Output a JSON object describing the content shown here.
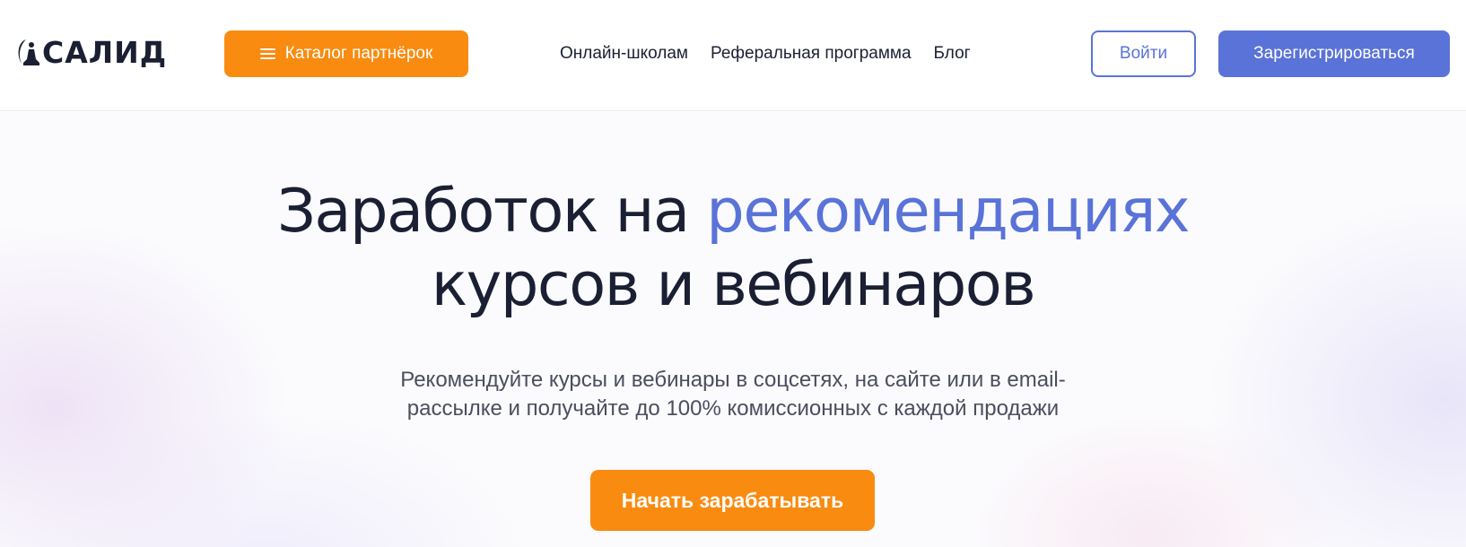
{
  "header": {
    "logo_text": "САЛИД",
    "logo_icon": "meditating-figure-icon",
    "catalog_button": {
      "label": "Каталог партнёрок",
      "icon": "menu-icon"
    },
    "nav": [
      {
        "label": "Онлайн-школам"
      },
      {
        "label": "Реферальная программа"
      },
      {
        "label": "Блог"
      }
    ],
    "login_label": "Войти",
    "register_label": "Зарегистрироваться"
  },
  "hero": {
    "headline_part1": "Заработок на ",
    "headline_accent": "рекомендациях",
    "headline_line2": "курсов и вебинаров",
    "subtitle_line1": "Рекомендуйте курсы и вебинары в соцсетях, на сайте или в email-",
    "subtitle_line2": "рассылке и получайте до 100% комиссионных с каждой продажи",
    "cta_label": "Начать зарабатывать"
  },
  "colors": {
    "brand_orange": "#f98b10",
    "brand_blue": "#5a73d8",
    "text_dark": "#1b1f33"
  }
}
